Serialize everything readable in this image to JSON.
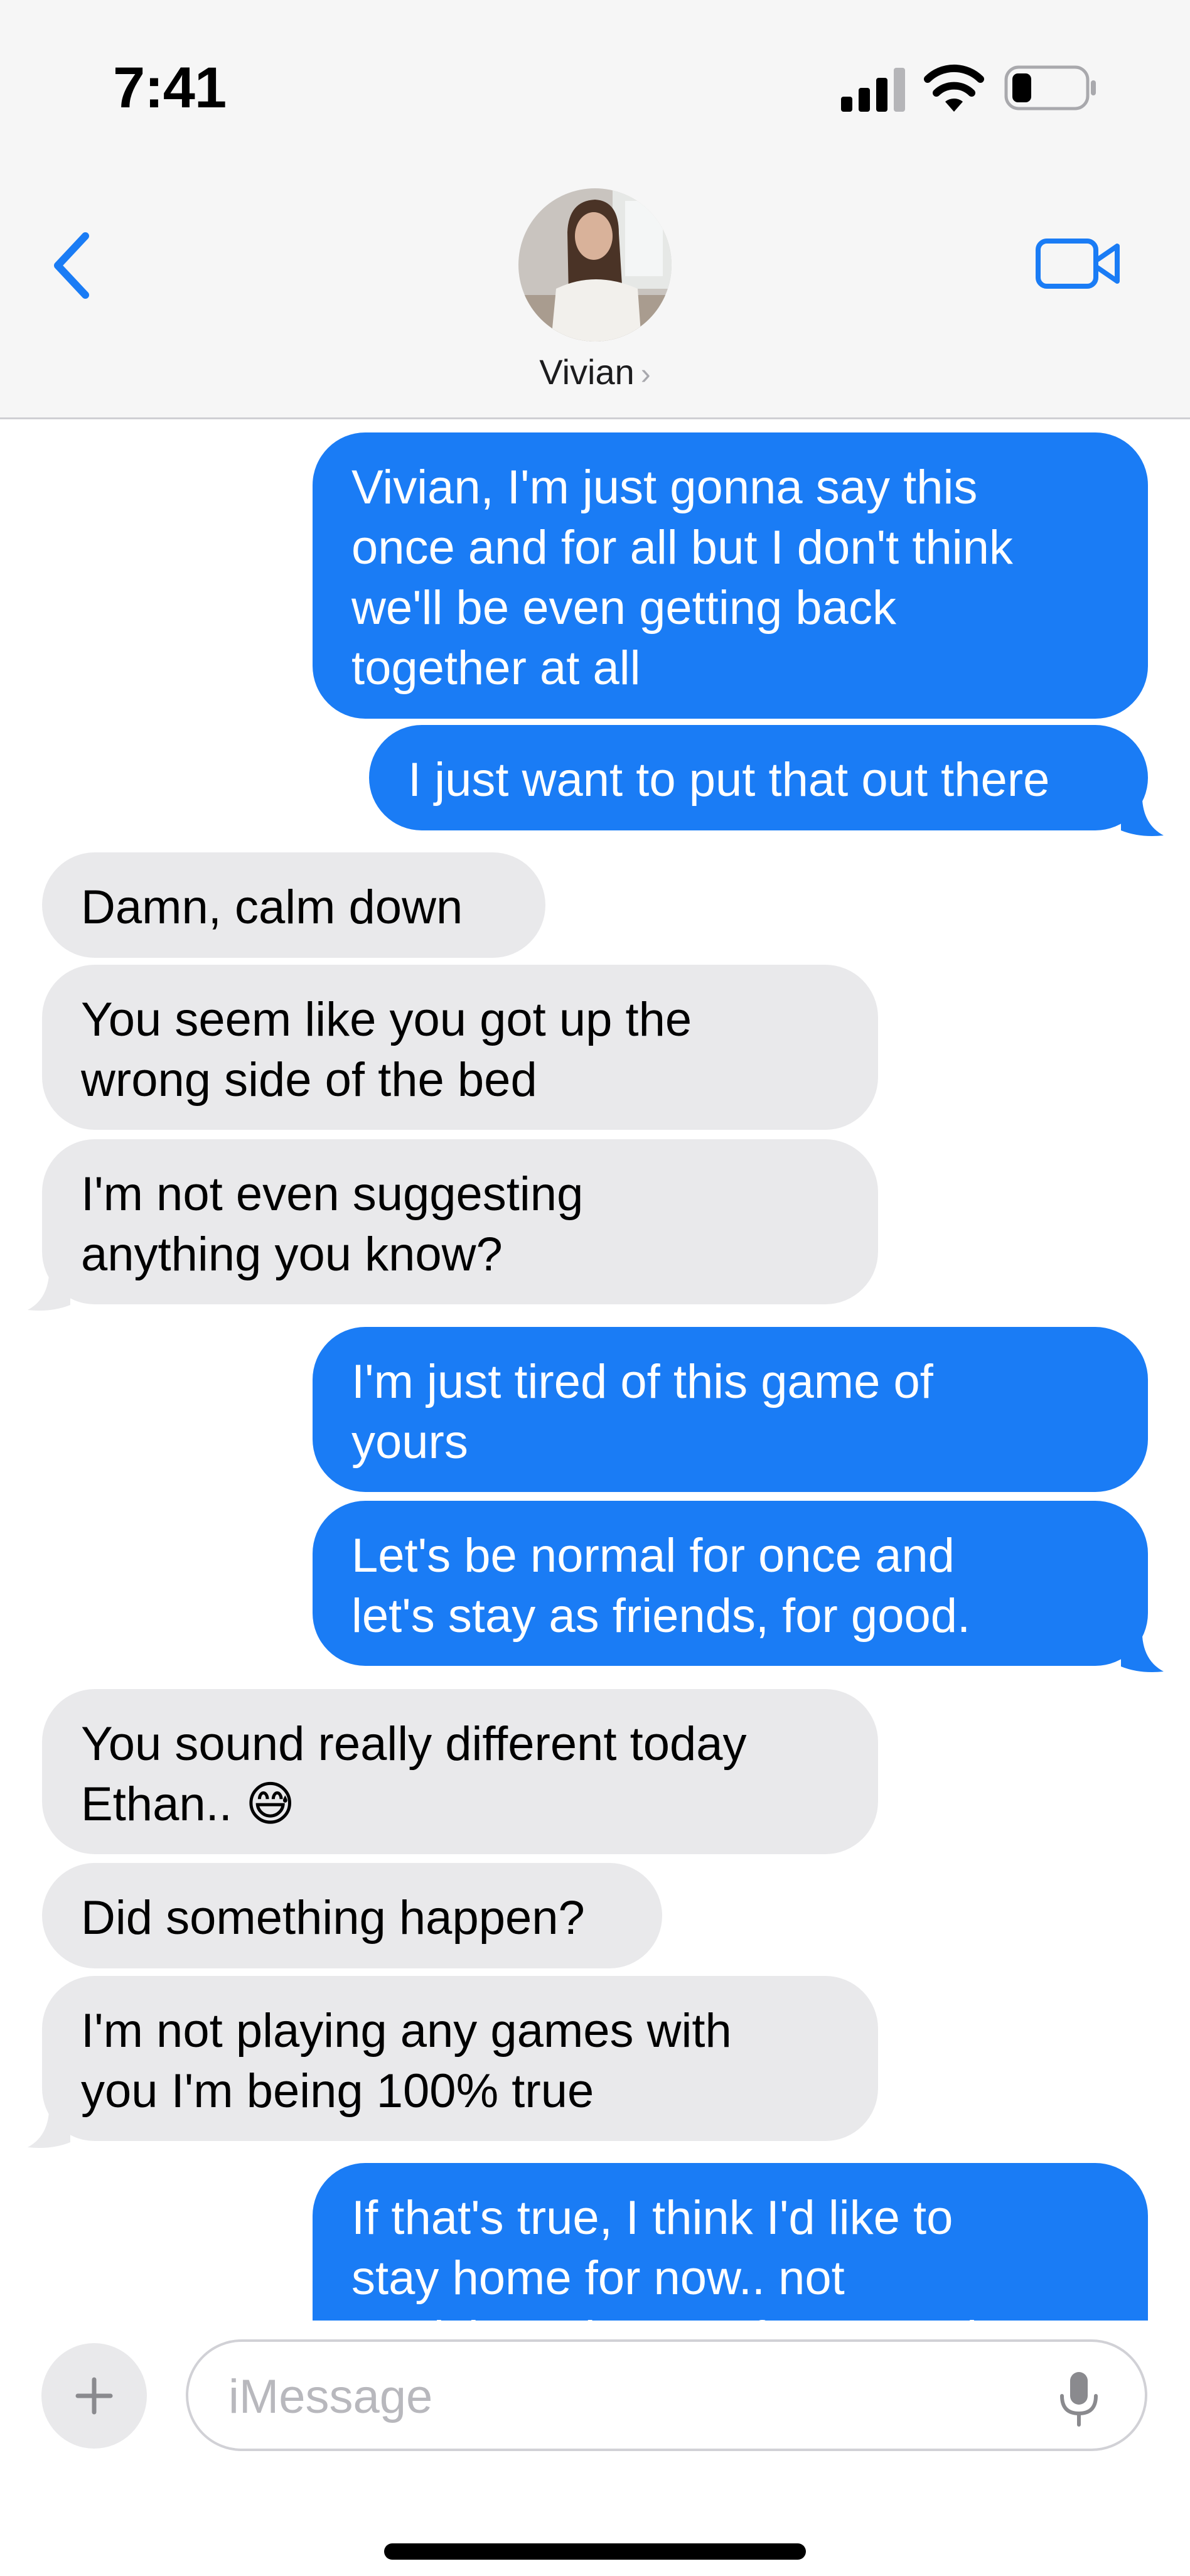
{
  "status_bar": {
    "time": "7:41"
  },
  "header": {
    "contact_name": "Vivian",
    "chevron": "›",
    "back_icon": "chevron-left-icon",
    "video_icon": "video-camera-icon"
  },
  "colors": {
    "outgoing": "#1a7cf5",
    "incoming": "#e9e9eb",
    "accent": "#1a7cf5"
  },
  "messages": [
    {
      "side": "out",
      "text": "Vivian, I'm just gonna say this\nonce and for all but I don't think\nwe'll be even getting back\ntogether at all"
    },
    {
      "side": "out",
      "text": "I just want to put that out there"
    },
    {
      "side": "in",
      "text": "Damn, calm down"
    },
    {
      "side": "in",
      "text": "You seem like you got up the\nwrong side of the bed"
    },
    {
      "side": "in",
      "text": "I'm not even suggesting\nanything you know?"
    },
    {
      "side": "out",
      "text": "I'm just tired of this game of\nyours"
    },
    {
      "side": "out",
      "text": "Let's be normal for once and\nlet's stay as friends, for good."
    },
    {
      "side": "in",
      "text": "You sound really different today\nEthan.. 😅"
    },
    {
      "side": "in",
      "text": "Did something happen?"
    },
    {
      "side": "in",
      "text": "I'm not playing any games with\nyou I'm being 100% true"
    },
    {
      "side": "out",
      "text": "If that's true, I think I'd like to\nstay home for now.. not\nparticipate in any of your parties"
    }
  ],
  "input": {
    "placeholder": "iMessage",
    "plus_icon": "plus-icon",
    "mic_icon": "microphone-icon"
  }
}
